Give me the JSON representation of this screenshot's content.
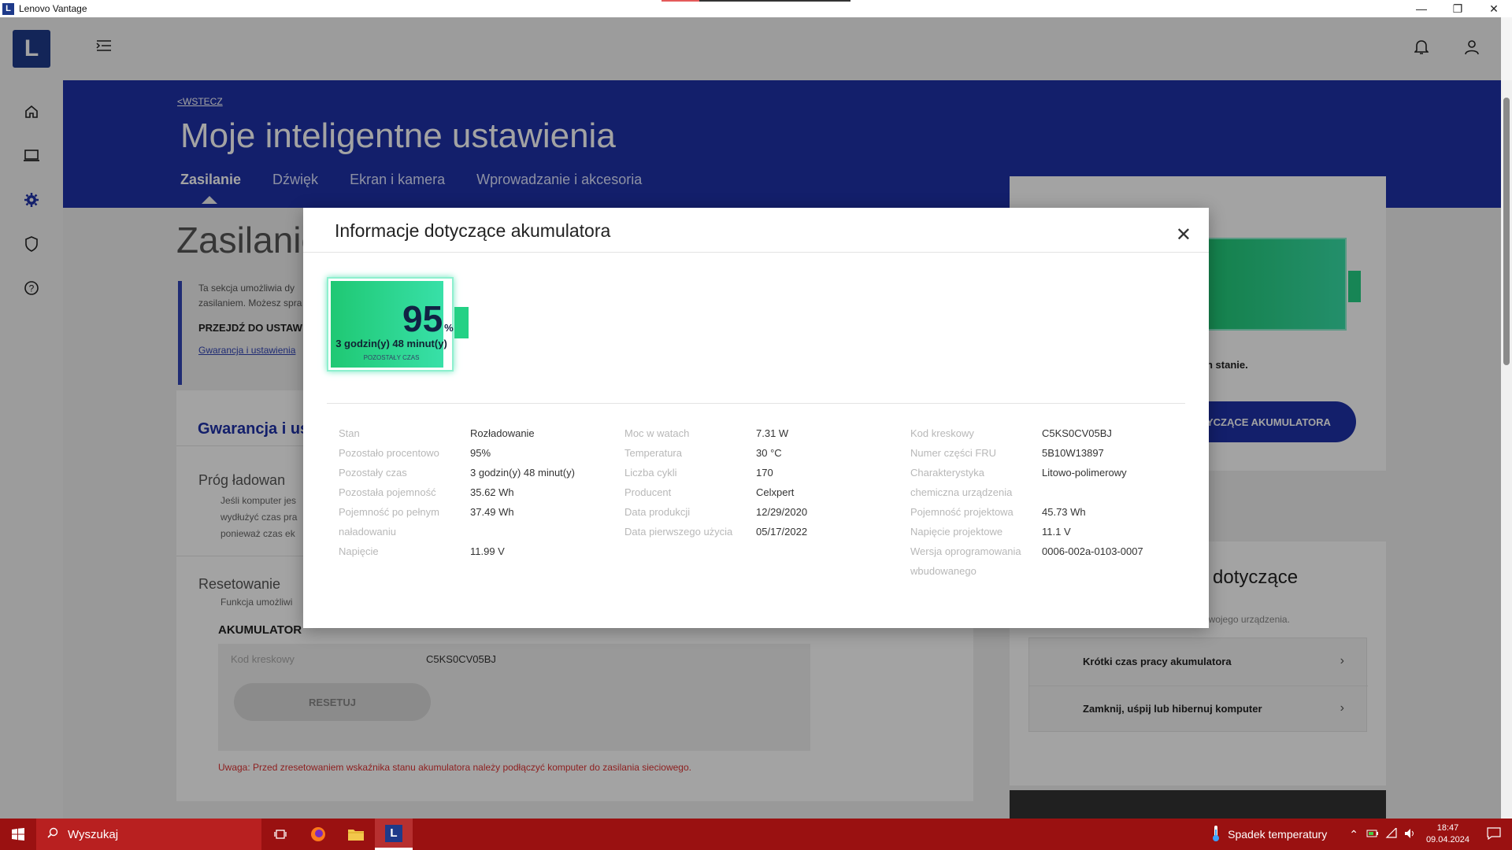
{
  "window": {
    "title": "Lenovo Vantage",
    "logo_letter": "L"
  },
  "header": {
    "back": "<WSTECZ",
    "page_title": "Moje inteligentne ustawienia",
    "tabs": [
      "Zasilanie",
      "Dźwięk",
      "Ekran i kamera",
      "Wprowadzanie i akcesoria"
    ]
  },
  "background": {
    "section_title": "Zasilanie",
    "info_text": "Ta sekcja umożliwia dy zasilaniem. Możesz spra",
    "goto": "PRZEJDŹ DO USTAW",
    "link": "Gwarancja i ustawienia",
    "card_title": "Gwarancja i ust",
    "item1_title": "Próg ładowan",
    "item1_desc": "Jeśli komputer jes wydłużyć czas pra ponieważ czas ek",
    "item2_title": "Resetowanie",
    "item2_desc": "Funkcja umożliwi",
    "akumulator": "AKUMULATOR",
    "barcode_label": "Kod kreskowy",
    "barcode_value": "C5KS0CV05BJ",
    "reset_button": "RESETUJ",
    "warning": "Uwaga: Przed zresetowaniem wskaźnika stanu akumulatora należy podłączyć komputer do zasilania sieciowego.",
    "right_status": "n stanie.",
    "right_button": "YCZĄCE AKUMULATORA",
    "right_card_title": "dotyczące",
    "right_card_desc": "Zobacz praktyczne wskazówki dotyczące Twojego urządzenia.",
    "right_item1": "Krótki czas pracy akumulatora",
    "right_item2": "Zamknij, uśpij lub hibernuj komputer"
  },
  "modal": {
    "title": "Informacje dotyczące akumulatora",
    "battery": {
      "percent": "95",
      "percent_unit": "%",
      "level": 0.95,
      "time": "3 godzin(y) 48 minut(y)",
      "sub": "POZOSTAŁY CZAS"
    },
    "col1": [
      {
        "label": "Stan",
        "value": "Rozładowanie"
      },
      {
        "label": "Pozostało procentowo",
        "value": "95%"
      },
      {
        "label": "Pozostały czas",
        "value": "3 godzin(y) 48 minut(y)"
      },
      {
        "label": "Pozostała pojemność",
        "value": "35.62 Wh"
      },
      {
        "label": "Pojemność po pełnym naładowaniu",
        "value": "37.49 Wh"
      },
      {
        "label": "Napięcie",
        "value": "11.99 V"
      }
    ],
    "col2": [
      {
        "label": "Moc w watach",
        "value": "7.31 W"
      },
      {
        "label": "Temperatura",
        "value": "30 °C"
      },
      {
        "label": "Liczba cykli",
        "value": "170"
      },
      {
        "label": "Producent",
        "value": "Celxpert"
      },
      {
        "label": "Data produkcji",
        "value": "12/29/2020"
      },
      {
        "label": "Data pierwszego użycia",
        "value": "05/17/2022"
      }
    ],
    "col3": [
      {
        "label": "Kod kreskowy",
        "value": "C5KS0CV05BJ"
      },
      {
        "label": "Numer części FRU",
        "value": "5B10W13897"
      },
      {
        "label": "Charakterystyka chemiczna urządzenia",
        "value": "Litowo-polimerowy"
      },
      {
        "label": "Pojemność projektowa",
        "value": "45.73 Wh"
      },
      {
        "label": "Napięcie projektowe",
        "value": "11.1 V"
      },
      {
        "label": "Wersja oprogramowania wbudowanego",
        "value": "0006-002a-0103-0007"
      }
    ]
  },
  "taskbar": {
    "search_placeholder": "Wyszukaj",
    "weather": "Spadek temperatury",
    "time": "18:47",
    "date": "09.04.2024"
  }
}
